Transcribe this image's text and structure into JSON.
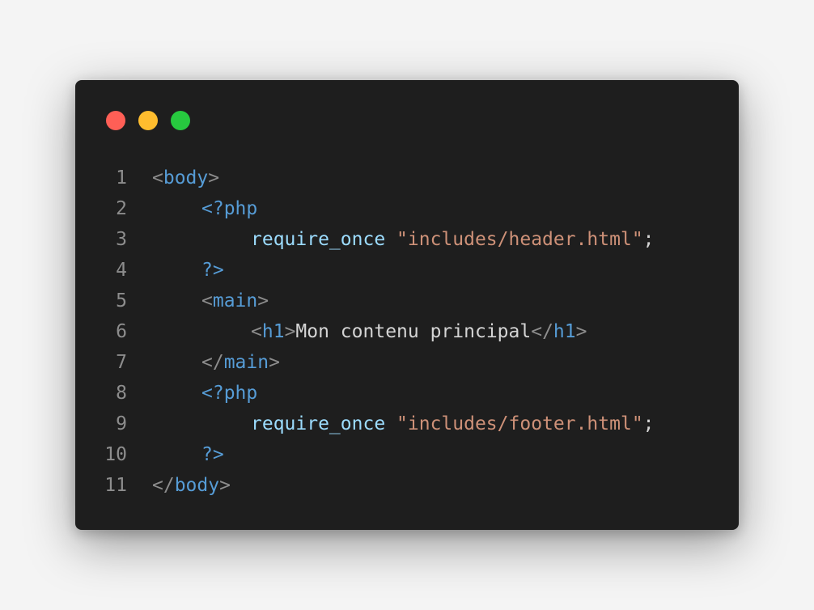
{
  "window": {
    "controls": [
      {
        "name": "close",
        "color": "#ff5f56"
      },
      {
        "name": "minimize",
        "color": "#ffbd2e"
      },
      {
        "name": "maximize",
        "color": "#27c93f"
      }
    ]
  },
  "colors": {
    "background": "#1e1e1e",
    "tag": "#569cd6",
    "bracket": "#8d8d8d",
    "function": "#9cdcfe",
    "string": "#ce9178",
    "text": "#d4d4d4",
    "line_number": "#8d8d8d"
  },
  "code": {
    "lines": [
      {
        "number": "1",
        "indent": 0,
        "tokens": [
          {
            "text": "<",
            "kind": "bracket"
          },
          {
            "text": "body",
            "kind": "tag"
          },
          {
            "text": ">",
            "kind": "bracket"
          }
        ]
      },
      {
        "number": "2",
        "indent": 1,
        "tokens": [
          {
            "text": "<?php",
            "kind": "tag"
          }
        ]
      },
      {
        "number": "3",
        "indent": 2,
        "tokens": [
          {
            "text": "require_once",
            "kind": "function"
          },
          {
            "text": " ",
            "kind": "text"
          },
          {
            "text": "\"includes/header.html\"",
            "kind": "string"
          },
          {
            "text": ";",
            "kind": "text"
          }
        ]
      },
      {
        "number": "4",
        "indent": 1,
        "tokens": [
          {
            "text": "?>",
            "kind": "tag"
          }
        ]
      },
      {
        "number": "5",
        "indent": 1,
        "tokens": [
          {
            "text": "<",
            "kind": "bracket"
          },
          {
            "text": "main",
            "kind": "tag"
          },
          {
            "text": ">",
            "kind": "bracket"
          }
        ]
      },
      {
        "number": "6",
        "indent": 2,
        "tokens": [
          {
            "text": "<",
            "kind": "bracket"
          },
          {
            "text": "h1",
            "kind": "tag"
          },
          {
            "text": ">",
            "kind": "bracket"
          },
          {
            "text": "Mon contenu principal",
            "kind": "text"
          },
          {
            "text": "</",
            "kind": "bracket"
          },
          {
            "text": "h1",
            "kind": "tag"
          },
          {
            "text": ">",
            "kind": "bracket"
          }
        ]
      },
      {
        "number": "7",
        "indent": 1,
        "tokens": [
          {
            "text": "</",
            "kind": "bracket"
          },
          {
            "text": "main",
            "kind": "tag"
          },
          {
            "text": ">",
            "kind": "bracket"
          }
        ]
      },
      {
        "number": "8",
        "indent": 1,
        "tokens": [
          {
            "text": "<?php",
            "kind": "tag"
          }
        ]
      },
      {
        "number": "9",
        "indent": 2,
        "tokens": [
          {
            "text": "require_once",
            "kind": "function"
          },
          {
            "text": " ",
            "kind": "text"
          },
          {
            "text": "\"includes/footer.html\"",
            "kind": "string"
          },
          {
            "text": ";",
            "kind": "text"
          }
        ]
      },
      {
        "number": "10",
        "indent": 1,
        "tokens": [
          {
            "text": "?>",
            "kind": "tag"
          }
        ]
      },
      {
        "number": "11",
        "indent": 0,
        "tokens": [
          {
            "text": "</",
            "kind": "bracket"
          },
          {
            "text": "body",
            "kind": "tag"
          },
          {
            "text": ">",
            "kind": "bracket"
          }
        ]
      }
    ]
  }
}
